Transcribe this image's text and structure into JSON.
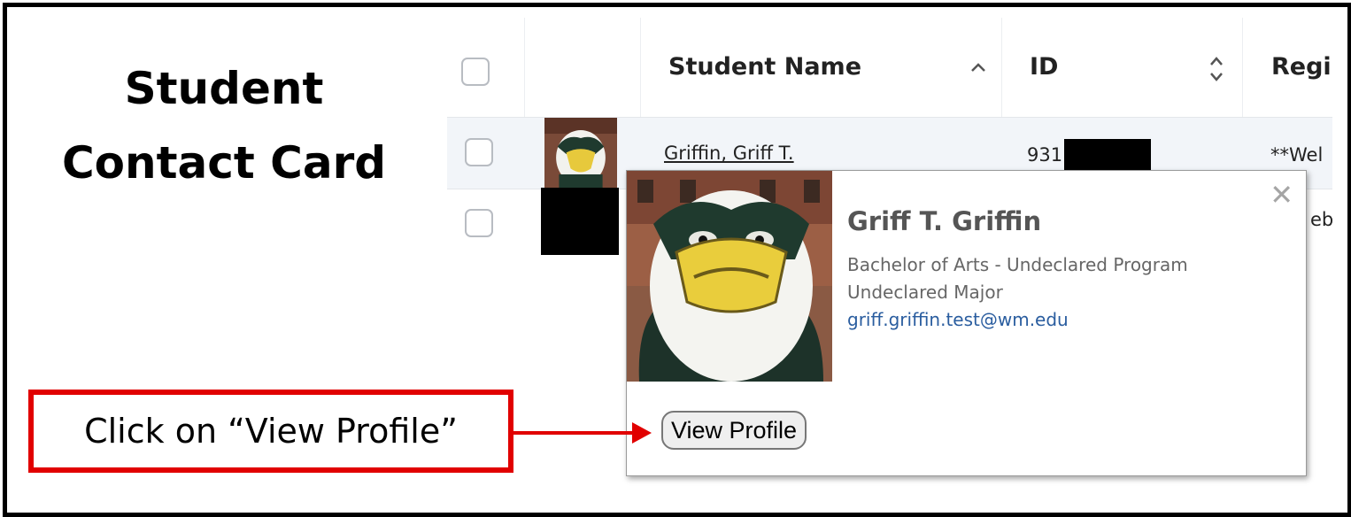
{
  "heading": {
    "line1": "Student",
    "line2": "Contact Card"
  },
  "table": {
    "columns": {
      "name": "Student Name",
      "id": "ID",
      "reg": "Regis"
    },
    "rows": [
      {
        "name": "Griffin, Griff T.",
        "id_prefix": "931",
        "reg": "**Wel"
      },
      {
        "reg": "eb"
      }
    ]
  },
  "popup": {
    "name": "Griff T. Griffin",
    "degree": "Bachelor of Arts - Undeclared Program",
    "major": "Undeclared Major",
    "email": "griff.griffin.test@wm.edu",
    "close_glyph": "✕",
    "view_profile": "View Profile"
  },
  "annotation": {
    "text": "Click on “View Profile”"
  },
  "icons": {
    "sort_up": "chevron-up-icon",
    "sort_both": "sort-icon",
    "close": "close-icon"
  },
  "colors": {
    "callout": "#e10000",
    "link": "#2a5d9f"
  }
}
